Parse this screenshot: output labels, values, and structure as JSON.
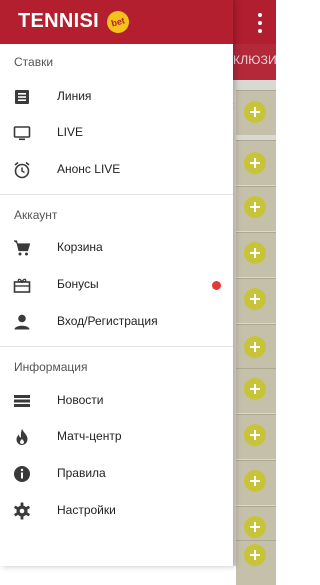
{
  "drawer": {
    "logo_text": "TENNISI",
    "logo_badge": "bet",
    "header_color": "#b31f2f",
    "sections": [
      {
        "title": "Ставки",
        "items": [
          {
            "label": "Линия",
            "icon": "list-icon"
          },
          {
            "label": "LIVE",
            "icon": "tv-icon"
          },
          {
            "label": "Анонс LIVE",
            "icon": "alarm-clock-icon"
          }
        ]
      },
      {
        "title": "Аккаунт",
        "items": [
          {
            "label": "Корзина",
            "icon": "cart-icon"
          },
          {
            "label": "Бонусы",
            "icon": "gift-icon",
            "notification": true,
            "notification_color": "#e53935"
          },
          {
            "label": "Вход/Регистрация",
            "icon": "person-icon"
          }
        ]
      },
      {
        "title": "Информация",
        "items": [
          {
            "label": "Новости",
            "icon": "news-icon"
          },
          {
            "label": "Матч-центр",
            "icon": "fire-icon"
          },
          {
            "label": "Правила",
            "icon": "info-icon"
          },
          {
            "label": "Настройки",
            "icon": "gear-icon"
          }
        ]
      }
    ]
  },
  "background": {
    "subbar_text": "КЛЮЗИВ",
    "accent": "#b01e2f",
    "add_button_color": "#c8c43a"
  }
}
